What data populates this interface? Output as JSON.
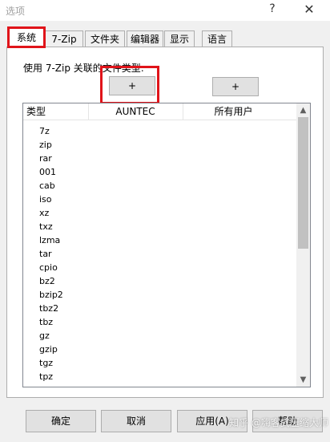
{
  "window": {
    "title": "选项",
    "help_label": "?",
    "close_label": "✕"
  },
  "tabs": [
    {
      "label": "系统",
      "active": true
    },
    {
      "label": "7-Zip"
    },
    {
      "label": "文件夹"
    },
    {
      "label": "编辑器"
    },
    {
      "label": "显示"
    },
    {
      "label": "语言"
    }
  ],
  "system": {
    "assoc_label": "使用 7-Zip 关联的文件类型:",
    "plus_current_user": "+",
    "plus_all_users": "+",
    "columns": [
      "类型",
      "AUNTEC",
      "所有用户"
    ],
    "types": [
      "7z",
      "zip",
      "rar",
      "001",
      "cab",
      "iso",
      "xz",
      "txz",
      "lzma",
      "tar",
      "cpio",
      "bz2",
      "bzip2",
      "tbz2",
      "tbz",
      "gz",
      "gzip",
      "tgz",
      "tpz"
    ]
  },
  "buttons": {
    "ok": "确定",
    "cancel": "取消",
    "apply": "应用(A)",
    "help": "帮助"
  },
  "watermark": "知乎 @嗨客式压缩大师",
  "colors": {
    "highlight": "#e0141a"
  }
}
